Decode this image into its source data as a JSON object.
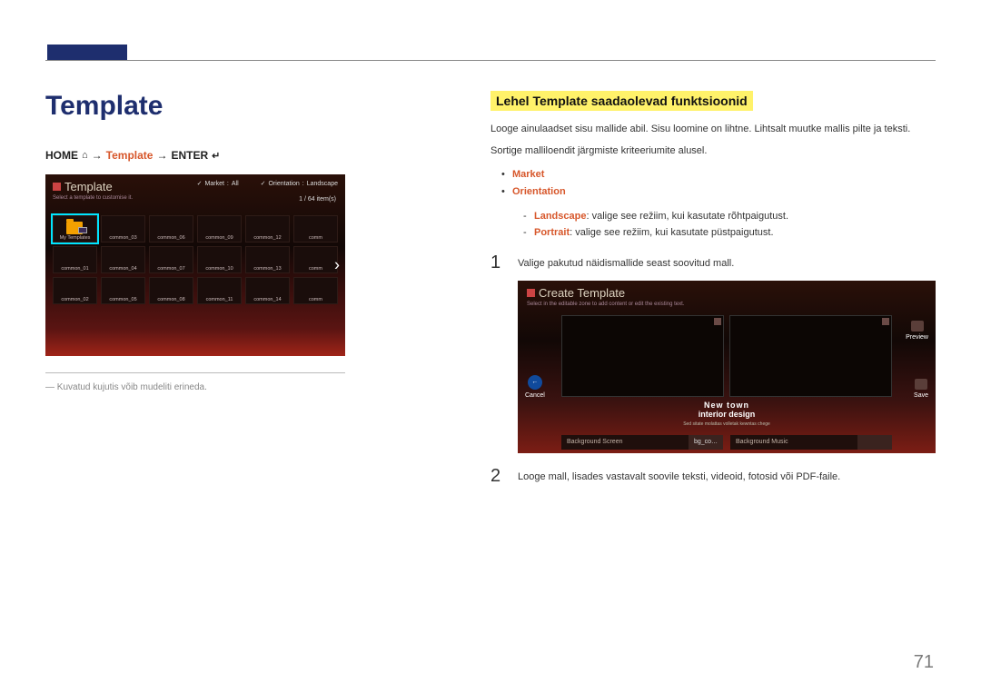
{
  "left": {
    "heading": "Template",
    "breadcrumb": {
      "home": "HOME",
      "template": "Template",
      "enter": "ENTER",
      "arrow": "→"
    },
    "panel": {
      "title": "Template",
      "subtitle": "Select a template to customise it.",
      "menu_market_label": "Market",
      "menu_market_value": "All",
      "menu_orient_label": "Orientation",
      "menu_orient_value": "Landscape",
      "count": "1 / 64 item(s)",
      "cells": [
        "My Templates",
        "common_03",
        "common_06",
        "common_09",
        "common_12",
        "comm",
        "common_01",
        "common_04",
        "common_07",
        "common_10",
        "common_13",
        "comm",
        "common_02",
        "common_05",
        "common_08",
        "common_11",
        "common_14",
        "comm"
      ]
    },
    "footnote_dash": "―",
    "footnote": "Kuvatud kujutis võib mudeliti erineda."
  },
  "right": {
    "section_title": "Lehel Template saadaolevad funktsioonid",
    "intro1": "Looge ainulaadset sisu mallide abil. Sisu loomine on lihtne. Lihtsalt muutke mallis pilte ja teksti.",
    "intro2": "Sortige malliloendit järgmiste kriteeriumite alusel.",
    "bullet_market": "Market",
    "bullet_orientation": "Orientation",
    "sub_landscape_key": "Landscape",
    "sub_landscape_rest": ": valige see režiim, kui kasutate rõhtpaigutust.",
    "sub_portrait_key": "Portrait",
    "sub_portrait_rest": ": valige see režiim, kui kasutate püstpaigutust.",
    "step1_num": "1",
    "step1_text": "Valige pakutud näidismallide seast soovitud mall.",
    "create_panel": {
      "title": "Create Template",
      "subtitle": "Select in the editable zone to add content or edit the existing text.",
      "cancel": "Cancel",
      "preview": "Preview",
      "save": "Save",
      "caption_line1": "New town",
      "caption_line2": "interior design",
      "caption_line3": "Sed sitate molattas volletak kewntas chege",
      "tab_bg_screen": "Background Screen",
      "tab_bg_btn": "bg_co…",
      "tab_bg_music": "Background Music",
      "tab_bg_music_btn": ""
    },
    "step2_num": "2",
    "step2_text": "Looge mall, lisades vastavalt soovile teksti, videoid, fotosid või PDF-faile."
  },
  "page_number": "71"
}
